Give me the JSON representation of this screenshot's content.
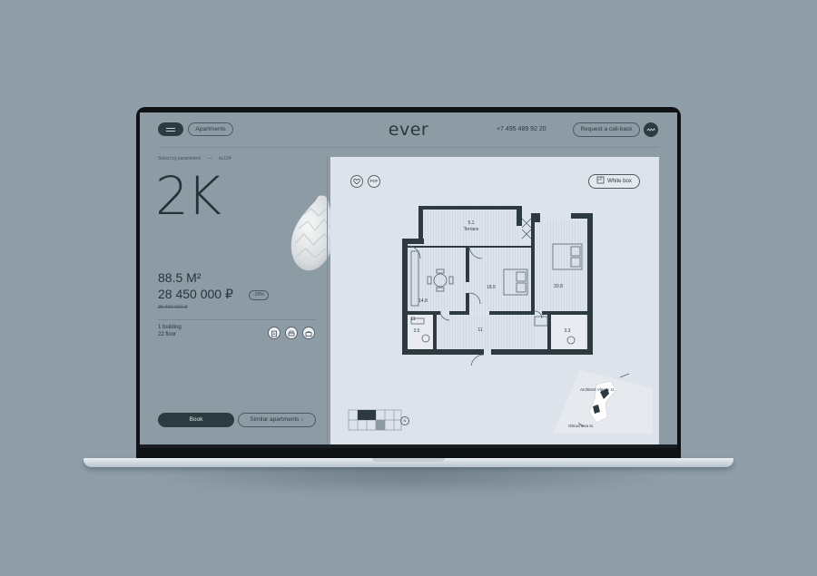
{
  "header": {
    "apartments_label": "Apartments",
    "logo": "ever",
    "phone": "+7 495 489 92 20",
    "callback_label": "Request a call-back"
  },
  "breadcrumb": {
    "item1": "Select by parameters",
    "item2": "№134"
  },
  "apartment": {
    "type": "2K",
    "area": "88.5 M²",
    "price": "28 450 000 ₽",
    "discount": "-20%",
    "old_price": "35 600 000 ₽",
    "building": "1 building",
    "floor": "22 floor"
  },
  "actions": {
    "book_label": "Book",
    "similar_label": "Similar apartments ↓"
  },
  "plan": {
    "pdf_label": "PDF",
    "whitebox_label": "White box",
    "rooms": {
      "terrace_area": "5.1",
      "terrace_label": "Terrace",
      "kitchen": "14.8",
      "bedroom1": "18.5",
      "bedroom2": "20.8",
      "hall": "11",
      "bath1": "3.5",
      "bath2": "3.3",
      "small": "11"
    },
    "compass_label": "N",
    "street_1": "Architect Vlasov st.",
    "street_2": "Obrucheva st."
  },
  "colors": {
    "dark": "#2c3b3f",
    "background": "#8f9ea9",
    "plan_bg": "#dde3ea"
  },
  "icons": [
    "menu-icon",
    "wave-icon",
    "heart-icon",
    "pdf-icon",
    "whitebox-icon",
    "document-icon",
    "printer-icon",
    "briefcase-icon"
  ]
}
